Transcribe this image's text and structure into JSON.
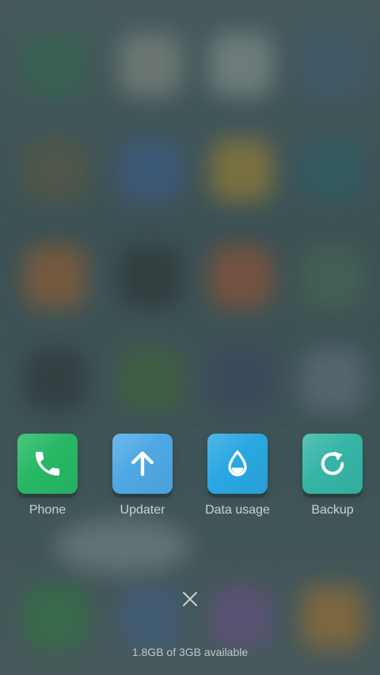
{
  "recent_apps": [
    {
      "label": "Phone",
      "icon": "phone-icon",
      "color": "#27b865"
    },
    {
      "label": "Updater",
      "icon": "arrow-up-icon",
      "color": "#4fa8e3"
    },
    {
      "label": "Data usage",
      "icon": "water-drop-icon",
      "color": "#2aa7e1"
    },
    {
      "label": "Backup",
      "icon": "refresh-icon",
      "color": "#35b5a6"
    }
  ],
  "close_icon": "close-icon",
  "memory_status": "1.8GB of 3GB available",
  "colors": {
    "background": "#3f5356",
    "label_text": "#c7d2d3",
    "memory_text": "#bfcacb"
  }
}
